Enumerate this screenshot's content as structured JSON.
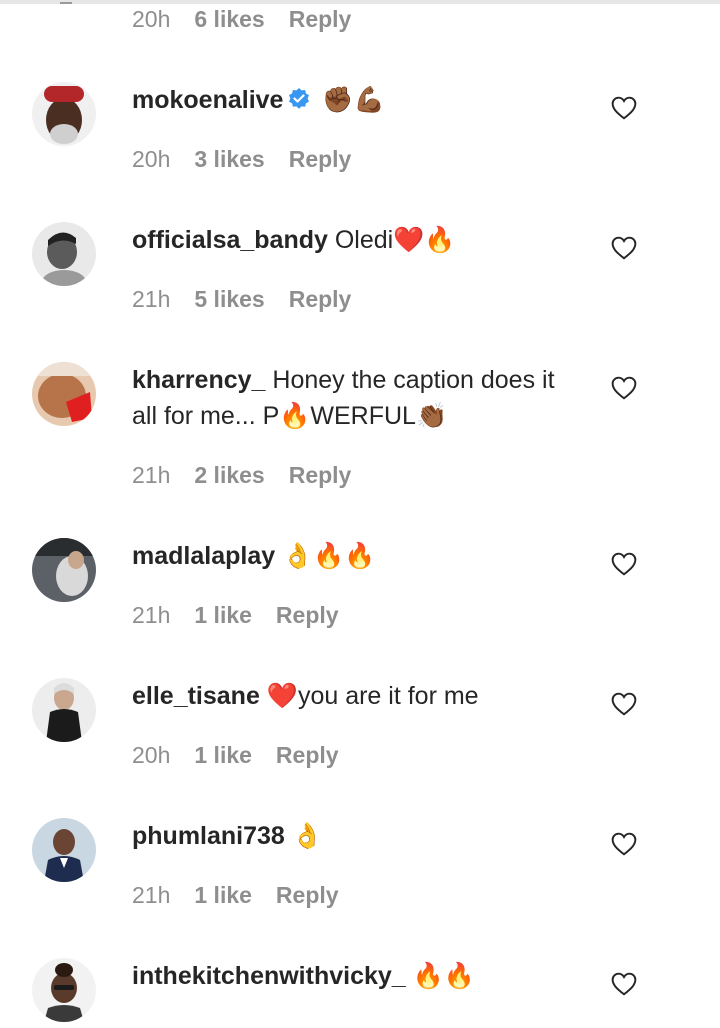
{
  "top_meta": {
    "time": "20h",
    "likes": "6 likes",
    "reply": "Reply"
  },
  "comments": [
    {
      "username": "mokoenalive",
      "verified": true,
      "text": "✊🏾💪🏾",
      "time": "20h",
      "likes": "3 likes",
      "reply": "Reply",
      "avatar_color": "#2b2b2b"
    },
    {
      "username": "officialsa_bandy",
      "verified": false,
      "text": "Oledi❤️🔥",
      "time": "21h",
      "likes": "5 likes",
      "reply": "Reply",
      "avatar_color": "#bdbdbd"
    },
    {
      "username": "kharrency_",
      "verified": false,
      "text": "Honey the caption does it all for me... P🔥WERFUL👏🏾",
      "time": "21h",
      "likes": "2 likes",
      "reply": "Reply",
      "avatar_color": "#c98a62"
    },
    {
      "username": "madlalaplay",
      "verified": false,
      "text": "👌🔥🔥",
      "time": "21h",
      "likes": "1 like",
      "reply": "Reply",
      "avatar_color": "#6b7075"
    },
    {
      "username": "elle_tisane",
      "verified": false,
      "text": "❤️you are it for me",
      "time": "20h",
      "likes": "1 like",
      "reply": "Reply",
      "avatar_color": "#d8d8d8"
    },
    {
      "username": "phumlani738",
      "verified": false,
      "text": "👌",
      "time": "21h",
      "likes": "1 like",
      "reply": "Reply",
      "avatar_color": "#9fb6c8"
    },
    {
      "username": "inthekitchenwithvicky_",
      "verified": false,
      "text": "🔥🔥",
      "time": "",
      "likes": "",
      "reply": "",
      "avatar_color": "#e3e3e3"
    }
  ]
}
